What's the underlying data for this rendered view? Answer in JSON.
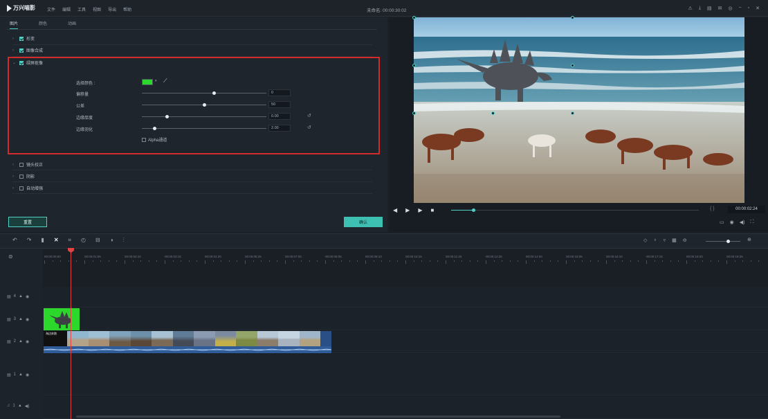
{
  "app": {
    "logo_text": "万兴喵影",
    "menus": [
      "文件",
      "编辑",
      "工具",
      "视图",
      "导出",
      "帮助"
    ],
    "project_title": "未命名: 00:00:30:02"
  },
  "tabs": [
    "图片",
    "颜色",
    "动画"
  ],
  "options": {
    "transform": "形变",
    "compositing": "图像合成",
    "chroma_key": "绿屏抠像",
    "lens_correction": "镜头校正",
    "shadow": "阴影",
    "auto_enhance": "自动增强"
  },
  "chroma_params": {
    "select_color_label": "选择颜色 :",
    "offset_label": "偏移量",
    "tolerance_label": "公差",
    "edge_thickness_label": "边缘厚度",
    "edge_feather_label": "边缘羽化",
    "offset_value": "0",
    "tolerance_value": "50",
    "edge_thickness_value": "0.00",
    "edge_feather_value": "2.00",
    "offset_level": 0.58,
    "tolerance_level": 0.5,
    "edge_thickness_level": 0.2,
    "edge_feather_level": 0.1,
    "alpha_channel_label": "Alpha通道",
    "key_color": "#2cd82c"
  },
  "buttons": {
    "reset": "重置",
    "ok": "确认"
  },
  "preview": {
    "timecode": "00:00:02:24",
    "progress": 0.09
  },
  "timeline": {
    "tick_labels": [
      "00:00:00:00",
      "00:00:01:05",
      "00:00:02:10",
      "00:00:03:15",
      "00:00:04:20",
      "00:00:05:25",
      "00:00:07:00",
      "00:00:08:05",
      "00:00:09:10",
      "00:00:10:15",
      "00:00:11:20",
      "00:00:12:25",
      "00:00:14:00",
      "00:00:15:05",
      "00:00:16:10",
      "00:00:17:15",
      "00:00:18:20",
      "00:00:19:25"
    ],
    "tracks": [
      "4",
      "3",
      "2",
      "1",
      "1"
    ],
    "video_clip_label": "海边奔跑"
  },
  "colors": {
    "accent": "#4fd1c5",
    "highlight_border": "#d42a2a",
    "playhead": "#e04545"
  }
}
